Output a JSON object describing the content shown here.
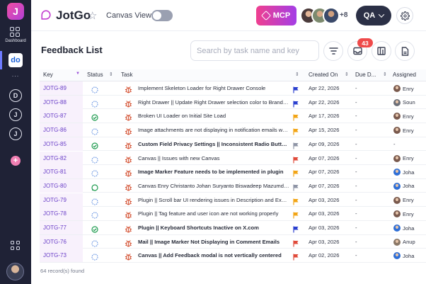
{
  "sidebar": {
    "logo_letter": "J",
    "dashboard_label": "Dashboard",
    "workspace_letters": "do",
    "more": "...",
    "project_letters": [
      "D",
      "J",
      "J"
    ]
  },
  "header": {
    "app_title": "JotGo",
    "canvas_view_label": "Canvas View",
    "canvas_view_on": false,
    "mcp_label": "MCP",
    "avatar_overflow": "+8",
    "role_label": "QA"
  },
  "toolbar": {
    "page_title": "Feedback List",
    "search_placeholder": "Search by task name and key",
    "notification_count": "43"
  },
  "table": {
    "columns": {
      "key": "Key",
      "status": "Status",
      "task": "Task",
      "created": "Created On",
      "due": "Due D...",
      "assigned": "Assigned"
    },
    "rows": [
      {
        "key": "JOTG-89",
        "status": "open",
        "summary": "Implement Skeleton Loader for Right Drawer Console",
        "bold": false,
        "flag": "#2a3fcf",
        "created": "Apr 22, 2026",
        "due": "-",
        "assignee": "Enry",
        "avatar": "#7a5a4e"
      },
      {
        "key": "JOTG-88",
        "status": "open",
        "summary": "Right Drawer || Update Right Drawer selection color to Brand Purple",
        "bold": false,
        "flag": "#2a3fcf",
        "created": "Apr 22, 2026",
        "due": "-",
        "assignee": "Soun",
        "avatar": "#6c6f78"
      },
      {
        "key": "JOTG-87",
        "status": "done",
        "summary": "Broken UI Loader on Initial Site Load",
        "bold": false,
        "flag": "#f2a516",
        "created": "Apr 17, 2026",
        "due": "-",
        "assignee": "Enry",
        "avatar": "#7a5a4e"
      },
      {
        "key": "JOTG-86",
        "status": "open",
        "summary": "Image attachments are not displaying in notification emails when a...",
        "bold": false,
        "flag": "#f2a516",
        "created": "Apr 15, 2026",
        "due": "-",
        "assignee": "Enry",
        "avatar": "#7a5a4e"
      },
      {
        "key": "JOTG-85",
        "status": "done",
        "summary": "Custom Field Privacy Settings || Inconsistent Radio Button Styling",
        "bold": true,
        "flag": "#8f95a6",
        "created": "Apr 09, 2026",
        "due": "-",
        "assignee": "-",
        "avatar": ""
      },
      {
        "key": "JOTG-82",
        "status": "open",
        "summary": "Canvas || Issues with new Canvas",
        "bold": false,
        "flag": "#e04a3a",
        "created": "Apr 07, 2026",
        "due": "-",
        "assignee": "Enry",
        "avatar": "#7a5a4e"
      },
      {
        "key": "JOTG-81",
        "status": "open",
        "summary": "Image Marker Feature needs to be implemented in plugin",
        "bold": true,
        "flag": "#f2a516",
        "created": "Apr 07, 2026",
        "due": "-",
        "assignee": "Joha",
        "avatar": "#2f6fd6"
      },
      {
        "key": "JOTG-80",
        "status": "chat",
        "summary": "Canvas Enry Christanto Johan Suryanto Biswadeep Mazumder pra...",
        "bold": false,
        "flag": "#8f95a6",
        "created": "Apr 07, 2026",
        "due": "-",
        "assignee": "Joha",
        "avatar": "#2f6fd6"
      },
      {
        "key": "JOTG-79",
        "status": "open",
        "summary": "Plugin || Scroll bar UI rendering issues in Description and Expecte...",
        "bold": false,
        "flag": "#f2a516",
        "created": "Apr 03, 2026",
        "due": "-",
        "assignee": "Enry",
        "avatar": "#7a5a4e"
      },
      {
        "key": "JOTG-78",
        "status": "open",
        "summary": "Plugin || Tag feature and user icon are not working properly",
        "bold": false,
        "flag": "#f2a516",
        "created": "Apr 03, 2026",
        "due": "-",
        "assignee": "Enry",
        "avatar": "#7a5a4e"
      },
      {
        "key": "JOTG-77",
        "status": "done",
        "summary": "Plugin || Keyboard Shortcuts Inactive on X.com",
        "bold": true,
        "flag": "#2a3fcf",
        "created": "Apr 03, 2026",
        "due": "-",
        "assignee": "Joha",
        "avatar": "#2f6fd6"
      },
      {
        "key": "JOTG-76",
        "status": "open",
        "summary": "Mail || Image Marker Not Displaying in Comment Emails",
        "bold": true,
        "flag": "#e04a3a",
        "created": "Apr 03, 2026",
        "due": "-",
        "assignee": "Anup",
        "avatar": "#8a7766"
      },
      {
        "key": "JOTG-73",
        "status": "open",
        "summary": "Canvas || Add Feedback modal is not vertically centered",
        "bold": true,
        "flag": "#e04a3a",
        "created": "Apr 02, 2026",
        "due": "-",
        "assignee": "Joha",
        "avatar": "#2f6fd6"
      }
    ]
  },
  "footer": {
    "records": "64 record(s) found"
  },
  "colors": {
    "rail": "#1f2236",
    "key_text": "#6a3fc8",
    "accent_done": "#1e9b4f",
    "badge": "#ef4a4a"
  }
}
